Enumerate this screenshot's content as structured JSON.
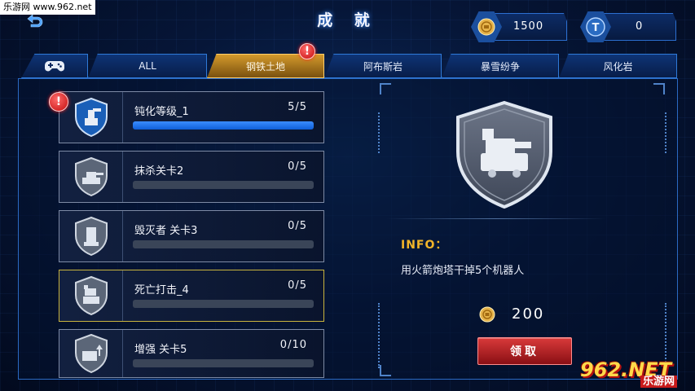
{
  "watermark": {
    "top_text": "乐游网 www.962.net",
    "logo_text": "962.NET",
    "logo_sub": "乐游网"
  },
  "header": {
    "title": "成 就"
  },
  "currency": {
    "coins": "1500",
    "tokens": "0",
    "token_icon_letter": "T"
  },
  "tabs": [
    {
      "label": "",
      "icon": "gamepad-icon"
    },
    {
      "label": "ALL"
    },
    {
      "label": "钢铁土地",
      "active": true,
      "alert": "!"
    },
    {
      "label": "阿布斯岩"
    },
    {
      "label": "暴雪纷争"
    },
    {
      "label": "风化岩"
    }
  ],
  "achievements": [
    {
      "name": "钝化等级_1",
      "progress_text": "5/5",
      "progress": 1.0,
      "alert": "!"
    },
    {
      "name": "抹杀关卡2",
      "progress_text": "0/5",
      "progress": 0
    },
    {
      "name": "毁灭者 关卡3",
      "progress_text": "0/5",
      "progress": 0
    },
    {
      "name": "死亡打击_4",
      "progress_text": "0/5",
      "progress": 0,
      "selected": true
    },
    {
      "name": "增强 关卡5",
      "progress_text": "0/10",
      "progress": 0
    }
  ],
  "detail": {
    "info_label": "INFO：",
    "description": "用火箭炮塔干掉5个机器人",
    "reward": "200",
    "claim_label": "领取"
  },
  "colors": {
    "accent_blue": "#2f7ad8",
    "active_tab": "#d49a2c",
    "info_label": "#f2b429",
    "progress_fill": "#1f6fea",
    "claim_button": "#c02a2a",
    "alert": "#d41515"
  }
}
